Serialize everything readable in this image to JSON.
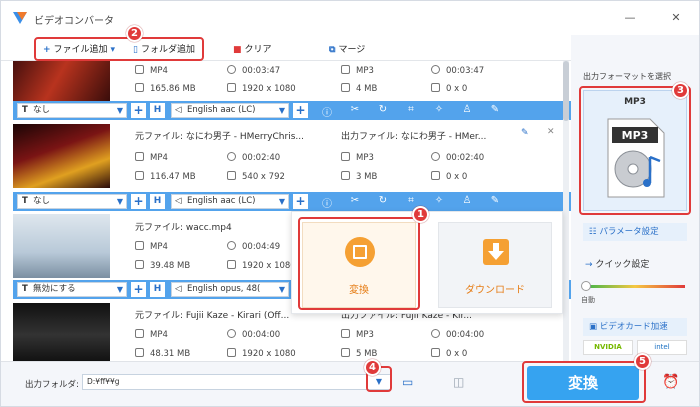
{
  "app": {
    "title": "ビデオコンバータ"
  },
  "toolbar": {
    "add_file": "ファイル追加",
    "add_folder": "フォルダ追加",
    "clear": "クリア",
    "merge": "マージ"
  },
  "items": [
    {
      "src": {
        "format": "MP4",
        "duration": "00:03:47",
        "size": "165.86 MB",
        "resolution": "1920 x 1080"
      },
      "out": {
        "format": "MP3",
        "duration": "00:03:47",
        "size": "4 MB",
        "resolution": "0 x 0"
      }
    },
    {
      "src_name": "元ファイル: なにわ男子 - HMerryChris...",
      "out_name": "出力ファイル: なにわ男子 - HMer...",
      "src": {
        "format": "MP4",
        "duration": "00:02:40",
        "size": "116.47 MB",
        "resolution": "540 x 792"
      },
      "out": {
        "format": "MP3",
        "duration": "00:02:40",
        "size": "3 MB",
        "resolution": "0 x 0"
      }
    },
    {
      "src_name": "元ファイル: wacc.mp4",
      "src": {
        "format": "MP4",
        "duration": "00:04:49",
        "size": "39.48 MB",
        "resolution": "1920 x 1080"
      }
    },
    {
      "src_name": "元ファイル: Fujii Kaze - Kirari (Off...",
      "out_name": "出力ファイル: Fujii Kaze - Kir...",
      "src": {
        "format": "MP4",
        "duration": "00:04:00",
        "size": "48.31 MB",
        "resolution": "1920 x 1080"
      },
      "out": {
        "format": "MP3",
        "duration": "00:04:00",
        "size": "5 MB",
        "resolution": "0 x 0"
      }
    }
  ],
  "bars": [
    {
      "subtitle": "なし",
      "audio": "English aac (LC)"
    },
    {
      "subtitle": "なし",
      "audio": "English aac (LC)"
    },
    {
      "subtitle": "無効にする",
      "audio": "English opus, 48("
    }
  ],
  "popup": {
    "convert": "変換",
    "download": "ダウンロード"
  },
  "right": {
    "format_label": "出力フォーマットを選択",
    "format": "MP3",
    "param_settings": "パラメータ設定",
    "quick_settings": "クイック設定",
    "auto_label": "自動",
    "gpu": "ビデオカード加速",
    "nvidia": "NVIDIA",
    "intel": "intel"
  },
  "bottom": {
    "output_folder_label": "出力フォルダ:",
    "output_folder_value": "D:¥ff¥¥g",
    "convert_button": "変換"
  },
  "badges": [
    "1",
    "2",
    "3",
    "4",
    "5"
  ],
  "colors": {
    "accent": "#53a3ec",
    "highlight": "#e03a3a",
    "orange": "#f5a033",
    "convert_btn": "#36a3f0"
  }
}
